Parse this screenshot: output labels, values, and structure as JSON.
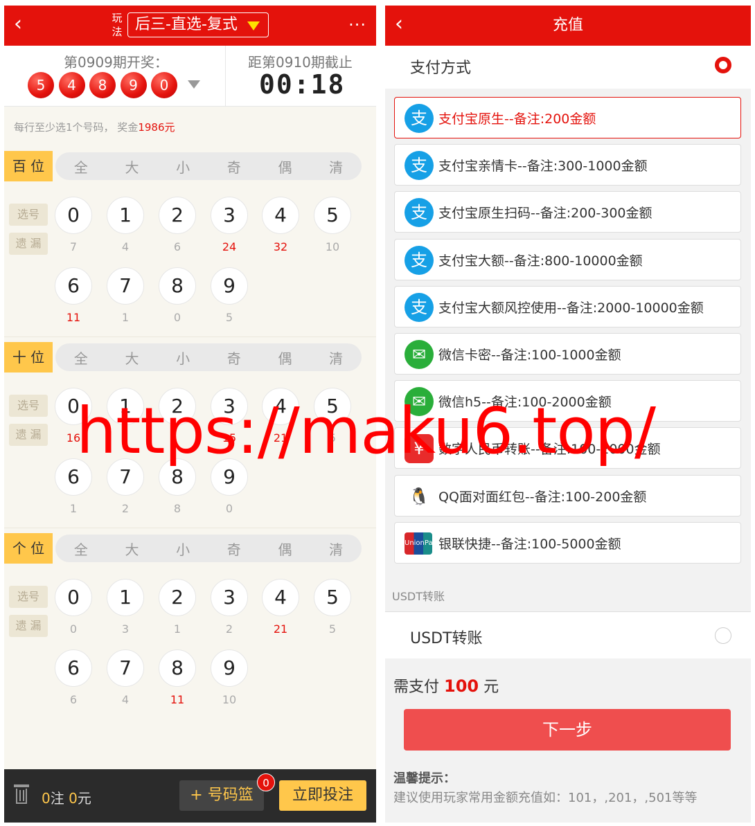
{
  "left": {
    "header": {
      "back_icon": "‹",
      "play_label": "玩法",
      "play_selected": "后三-直选-复式",
      "more_icon": "···"
    },
    "draw": {
      "last_title": "第0909期开奖：",
      "balls": [
        "5",
        "4",
        "8",
        "9",
        "0"
      ],
      "next_title": "距第0910期截止",
      "countdown": "00:18"
    },
    "hint_prefix": "每行至少选1个号码，  奖金",
    "hint_amount": "1986元",
    "quick_select": [
      "全",
      "大",
      "小",
      "奇",
      "偶",
      "清"
    ],
    "tag_select": "选号",
    "tag_miss": "遗 漏",
    "positions": [
      {
        "label": "百 位",
        "miss": [
          "7",
          "4",
          "6",
          "24",
          "32",
          "10",
          "11",
          "1",
          "0",
          "5"
        ],
        "hot": [
          3,
          4,
          6
        ]
      },
      {
        "label": "十 位",
        "miss": [
          "16",
          "",
          "",
          "15",
          "21",
          "5",
          "1",
          "2",
          "8",
          "0"
        ],
        "hot": [
          0,
          3,
          4
        ]
      },
      {
        "label": "个 位",
        "miss": [
          "0",
          "3",
          "1",
          "2",
          "21",
          "5",
          "6",
          "4",
          "11",
          "10"
        ],
        "hot": [
          4,
          8
        ]
      }
    ],
    "digits": [
      "0",
      "1",
      "2",
      "3",
      "4",
      "5",
      "6",
      "7",
      "8",
      "9"
    ],
    "footer": {
      "count_num": "0",
      "count_unit": "注 ",
      "amount_num": "0",
      "amount_unit": "元",
      "basket": "+ 号码篮",
      "badge": "0",
      "bet": "立即投注"
    }
  },
  "right": {
    "header": {
      "back_icon": "‹",
      "title": "充值"
    },
    "pay_method_label": "支付方式",
    "options": [
      {
        "icon": "alipay-icon",
        "glyph": "支",
        "text": "支付宝原生--备注:200金额",
        "selected": true
      },
      {
        "icon": "alipay-icon",
        "glyph": "支",
        "text": "支付宝亲情卡--备注:300-1000金额"
      },
      {
        "icon": "alipay-icon",
        "glyph": "支",
        "text": "支付宝原生扫码--备注:200-300金额"
      },
      {
        "icon": "alipay-icon",
        "glyph": "支",
        "text": "支付宝大额--备注:800-10000金额"
      },
      {
        "icon": "alipay-icon",
        "glyph": "支",
        "text": "支付宝大额风控使用--备注:2000-10000金额"
      },
      {
        "icon": "wechat-icon",
        "glyph": "✉",
        "text": "微信卡密--备注:100-1000金额"
      },
      {
        "icon": "wechat-icon",
        "glyph": "✉",
        "text": "微信h5--备注:100-2000金额"
      },
      {
        "icon": "digital-rmb-icon",
        "glyph": "¥",
        "text": "数字人民币转账--备注:100-2000金额"
      },
      {
        "icon": "qq-icon",
        "glyph": "🐧",
        "text": "QQ面对面红包--备注:100-200金额"
      },
      {
        "icon": "unionpay-icon",
        "glyph": "UnionPay",
        "text": "银联快捷--备注:100-5000金额"
      }
    ],
    "usdt_section": "USDT转账",
    "usdt_option": "USDT转账",
    "need_pay_prefix": "需支付",
    "need_pay_amount": "100",
    "need_pay_unit": "元",
    "next_button": "下一步",
    "tip_title": "温馨提示：",
    "tip_text": "建议使用玩家常用金额充值如：101，,201，,501等等"
  },
  "watermark": "https://maku6.top/",
  "colors": {
    "brand_red": "#e4120c",
    "gold": "#ffc74b",
    "alipay": "#16a0e6",
    "wechat": "#2aae3a"
  }
}
